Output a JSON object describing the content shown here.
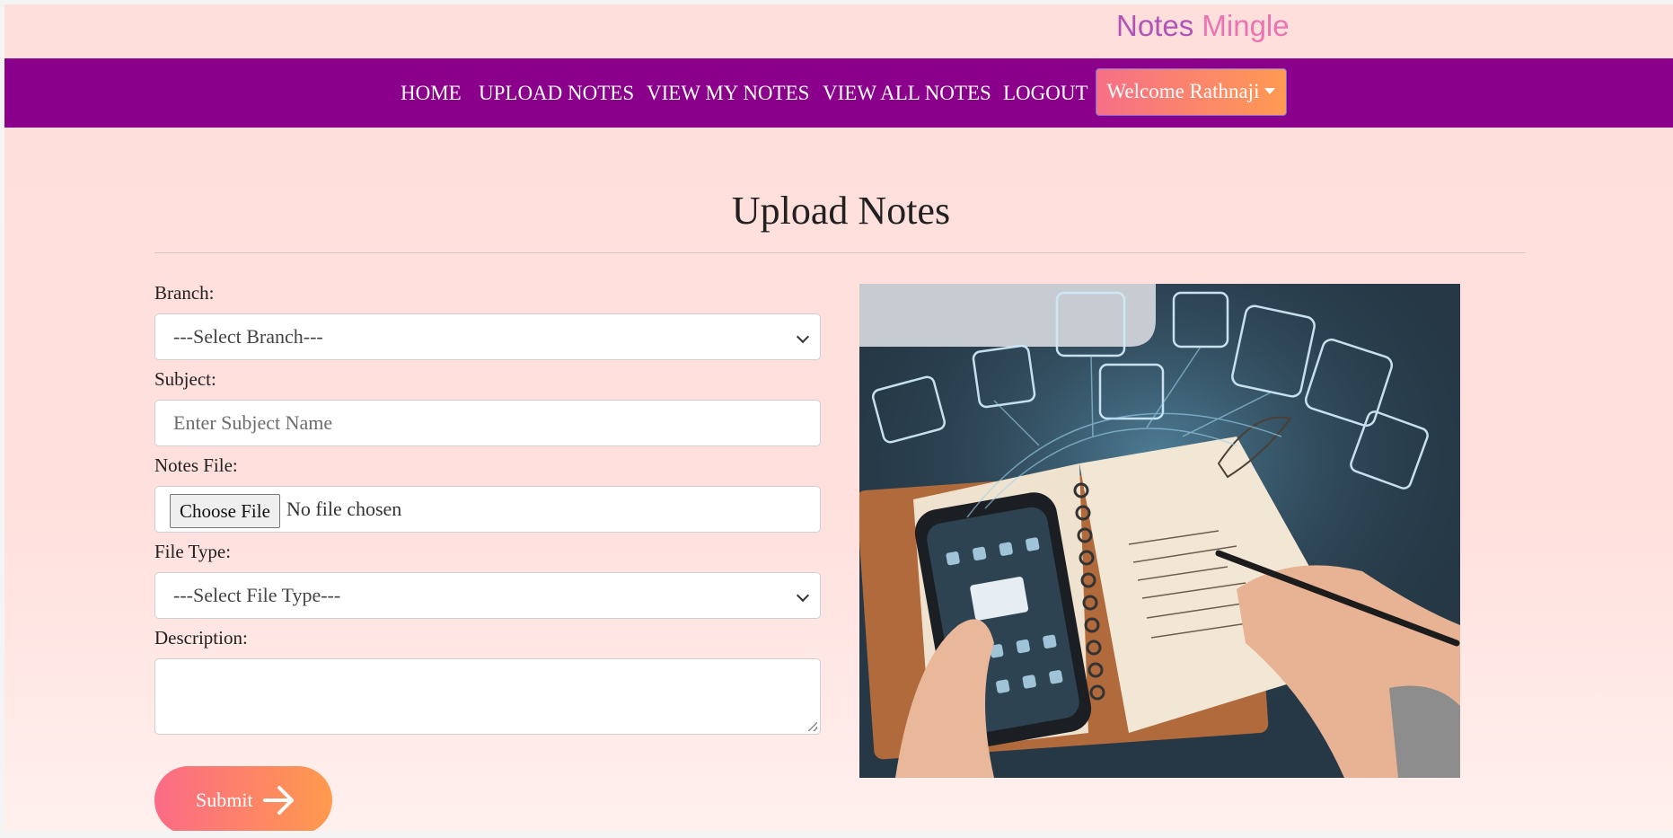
{
  "brand": {
    "part1": "Notes",
    "part2": "Mingle"
  },
  "nav": {
    "items": [
      {
        "label": "HOME"
      },
      {
        "label": "UPLOAD NOTES"
      },
      {
        "label": "VIEW MY NOTES"
      },
      {
        "label": "VIEW ALL NOTES"
      },
      {
        "label": "LOGOUT"
      }
    ],
    "welcome": "Welcome Rathnaji"
  },
  "page": {
    "title": "Upload Notes"
  },
  "form": {
    "branch": {
      "label": "Branch:",
      "selected": "---Select Branch---"
    },
    "subject": {
      "label": "Subject:",
      "placeholder": "Enter Subject Name"
    },
    "notes_file": {
      "label": "Notes File:",
      "button": "Choose File",
      "status": "No file chosen"
    },
    "file_type": {
      "label": "File Type:",
      "selected": "---Select File Type---"
    },
    "description": {
      "label": "Description:",
      "value": ""
    },
    "submit": {
      "label": "Submit"
    }
  },
  "colors": {
    "navbar": "#8b008b",
    "brand_primary": "#b154b8",
    "brand_secondary": "#ea74b3",
    "button_gradient_start": "#fb6b86",
    "button_gradient_end": "#ff9a4d"
  },
  "icons": {
    "submit": "arrow-right-icon",
    "dropdown": "caret-down-icon",
    "select": "chevron-down-icon"
  }
}
